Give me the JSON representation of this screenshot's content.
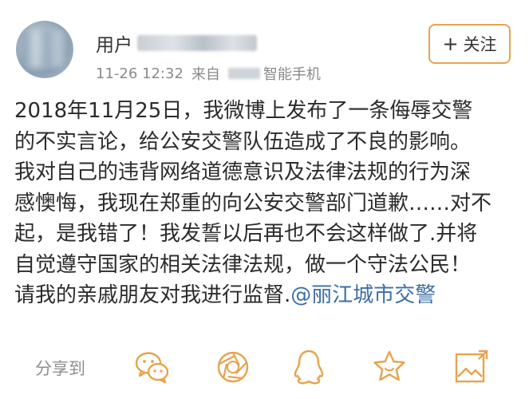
{
  "post": {
    "author": {
      "name_prefix": "用户"
    },
    "timestamp": "11-26 12:32",
    "source_prefix": "来自",
    "source_suffix": "智能手机",
    "follow_button": {
      "plus": "+",
      "label": "关注"
    },
    "content_lines": [
      "2018年11月25日，我微博上发布了一条侮辱交警",
      "的不实言论，给公安交警队伍造成了不良的影响。",
      "我对自己的违背网络道德意识及法律法规的行为深",
      "感懊悔，我现在郑重的向公安交警部门道歉……对不",
      "起，是我错了！我发誓以后再也不会这样做了.并将",
      "自觉遵守国家的相关法律法规，做一个守法公民！",
      "请我的亲戚朋友对我进行监督."
    ],
    "mention": "@丽江城市交警"
  },
  "share_bar": {
    "label": "分享到",
    "icons": [
      "wechat-icon",
      "moments-icon",
      "qq-icon",
      "favorite-star-icon",
      "image-save-icon"
    ],
    "accent_color": "#e8a24d"
  }
}
